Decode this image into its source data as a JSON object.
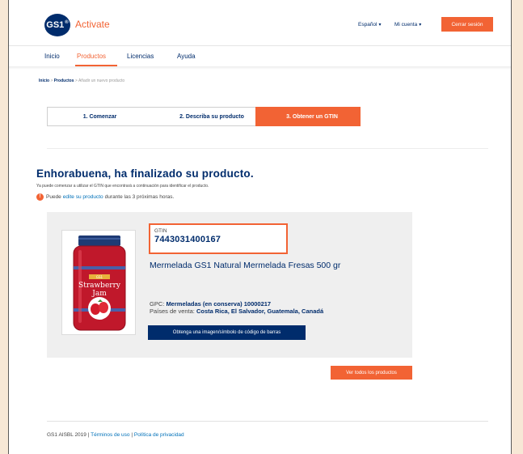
{
  "header": {
    "logo_text": "GS1",
    "logo_sup": "®",
    "app_name": "Activate",
    "language": "Español",
    "account": "Mi cuenta",
    "logout": "Cerrar sesión"
  },
  "nav": {
    "items": [
      {
        "label": "Inicio"
      },
      {
        "label": "Productos"
      },
      {
        "label": "Licencias"
      },
      {
        "label": "Ayuda"
      }
    ],
    "active": "Productos"
  },
  "breadcrumb": {
    "home": "Inicio",
    "sep": ">",
    "section": "Productos",
    "current": "Añadir un nuevo producto"
  },
  "steps": [
    {
      "label": "1. Comenzar"
    },
    {
      "label": "2. Describa su producto"
    },
    {
      "label": "3. Obtener un GTIN"
    }
  ],
  "main": {
    "title": "Enhorabuena, ha finalizado su producto.",
    "subtitle": "Ya puede comenzar a utilizar el GTIN que encontrará a continuación para identificar el producto.",
    "notice_pre": "Puede",
    "notice_link": "edite su producto",
    "notice_post": "durante las 3 próximas horas."
  },
  "product": {
    "gtin_label": "GTIN",
    "gtin": "7443031400167",
    "name": "Mermelada GS1 Natural Mermelada Fresas 500 gr",
    "gpc_label": "GPC:",
    "gpc_value": "Mermeladas (en conserva) 10000217",
    "sales_label": "Países de venta:",
    "sales_value": "Costa Rica, El Salvador, Guatemala, Canadá",
    "barcode_button": "Obtenga una imagen/símbolo de código de barras",
    "jar_brand": "GS1",
    "jar_line1": "Strawberry",
    "jar_line2": "Jam"
  },
  "actions": {
    "view_all": "Ver todos los productos"
  },
  "footer": {
    "copyright": "GS1 AISBL 2019",
    "sep1": "|",
    "terms": "Términos de uso",
    "sep2": "|",
    "privacy": "Política de privacidad"
  },
  "colors": {
    "accent": "#f26334",
    "brand": "#002c6c",
    "link": "#0071b9"
  }
}
